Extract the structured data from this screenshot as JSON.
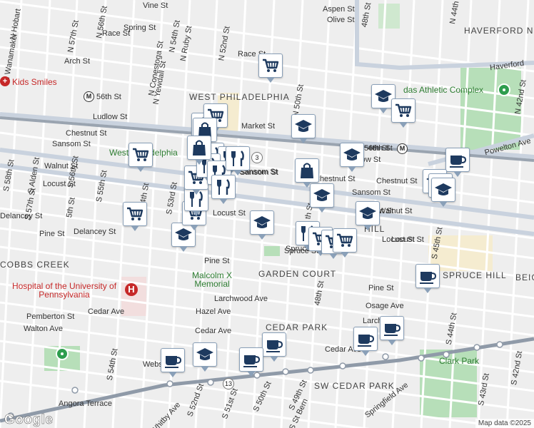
{
  "streets": [
    "Vine St",
    "Aspen St",
    "Olive St",
    "Spring St",
    "Race St",
    "Race St",
    "Arch St",
    "Ludlow St",
    "Market St",
    "Chestnut St",
    "Chestnut St",
    "Sansom St",
    "Sansom St",
    "Sansom St",
    "Walnut St",
    "Walnut St",
    "Locust St",
    "Locust St",
    "Locust St",
    "Delancey St",
    "Delancey St",
    "Pine St",
    "Pine St",
    "Pine St",
    "Larchwood Ave",
    "Hazel Ave",
    "Cedar Ave",
    "Cedar Ave",
    "Cedar Ave",
    "Osage Ave",
    "Larch",
    "Pemberton St",
    "Walton Ave",
    "Webster",
    "Angora Terrace",
    "Whitby Ave",
    "Springfield Ave",
    "Powelton Ave",
    "Haverford",
    "N 57th St",
    "N 56th St",
    "N Hobart",
    "N Wanamaker",
    "N Conestoga St",
    "N Yewdall St",
    "N 54th St",
    "N Ruby St",
    "N 52nd St",
    "N 50th St",
    "48th St",
    "S 58th St",
    "S Alden St",
    "S 57th St",
    "S 56th St",
    "S 55th St",
    "S 54th St",
    "S 53rd St",
    "S 52nd St",
    "S 51st St",
    "S 50th St",
    "S 49th St",
    "S St Bern",
    "48th St",
    "S 45th St",
    "S 44th St",
    "S 43rd St",
    "S 42nd St",
    "N 42nd St",
    "N 44th St",
    "5th St",
    "54th St",
    "Ludlow St",
    "56th St",
    "Sansom St",
    "Chestnut St",
    "Walnut St",
    "Locust St",
    "Spruce St",
    "Spruce St",
    "th St"
  ],
  "places": {
    "haverford_north": "HAVERFORD NORTH",
    "west_philadelphia": "WEST PHILADELPHIA",
    "west_philadelphia_short": "West Philadelphia",
    "cobbs_creek": "COBBS CREEK",
    "garden_court": "GARDEN COURT",
    "cedar_park": "CEDAR PARK",
    "sw_cedar_park": "SW CEDAR PARK",
    "spruce_hill": "SPRUCE HILL",
    "beig": "BEIG",
    "hill": "HILL"
  },
  "pois": {
    "kids_smiles": "Kids Smiles",
    "athletic_complex": "das Athletic Complex",
    "hospital": "Hospital of the University of Pennsylvania",
    "malcolm_x": "Malcolm X Memorial",
    "clark_park": "Clark Park"
  },
  "metro": {
    "st56": "56th St",
    "st46": "46th St"
  },
  "route_shields": [
    "3",
    "13"
  ],
  "markers": [
    {
      "icon": "shopping-cart-icon"
    },
    {
      "icon": "graduation-cap-icon"
    },
    {
      "icon": "shopping-cart-icon"
    },
    {
      "icon": "shopping-bag-icon"
    },
    {
      "icon": "graduation-cap-icon"
    },
    {
      "icon": "shopping-cart-icon"
    },
    {
      "icon": "shopping-bag-icon"
    },
    {
      "icon": "graduation-cap-icon"
    },
    {
      "icon": "coffee-cup-icon"
    },
    {
      "icon": "restaurant-icon"
    },
    {
      "icon": "restaurant-icon"
    },
    {
      "icon": "graduation-cap-icon"
    },
    {
      "icon": "graduation-cap-icon"
    },
    {
      "icon": "graduation-cap-icon"
    },
    {
      "icon": "shopping-cart-icon"
    },
    {
      "icon": "shopping-cart-icon"
    },
    {
      "icon": "graduation-cap-icon"
    },
    {
      "icon": "shopping-cart-icon"
    },
    {
      "icon": "restaurant-icon"
    },
    {
      "icon": "shopping-cart-icon"
    },
    {
      "icon": "coffee-cup-icon"
    },
    {
      "icon": "coffee-cup-icon"
    },
    {
      "icon": "coffee-cup-icon"
    },
    {
      "icon": "coffee-cup-icon"
    },
    {
      "icon": "coffee-cup-icon"
    },
    {
      "icon": "graduation-cap-icon"
    },
    {
      "icon": "coffee-cup-icon"
    }
  ],
  "branding": {
    "logo": "Google",
    "attribution": "Map data ©2025"
  },
  "colors": {
    "background": "#eeeeee",
    "street": "#ffffff",
    "arterial": "#c9d2de",
    "rail": "#8f9aa8",
    "park": "#b7dfb9",
    "marker_icon": "#1e3a5f",
    "marker_border": "#8aa0b8"
  }
}
